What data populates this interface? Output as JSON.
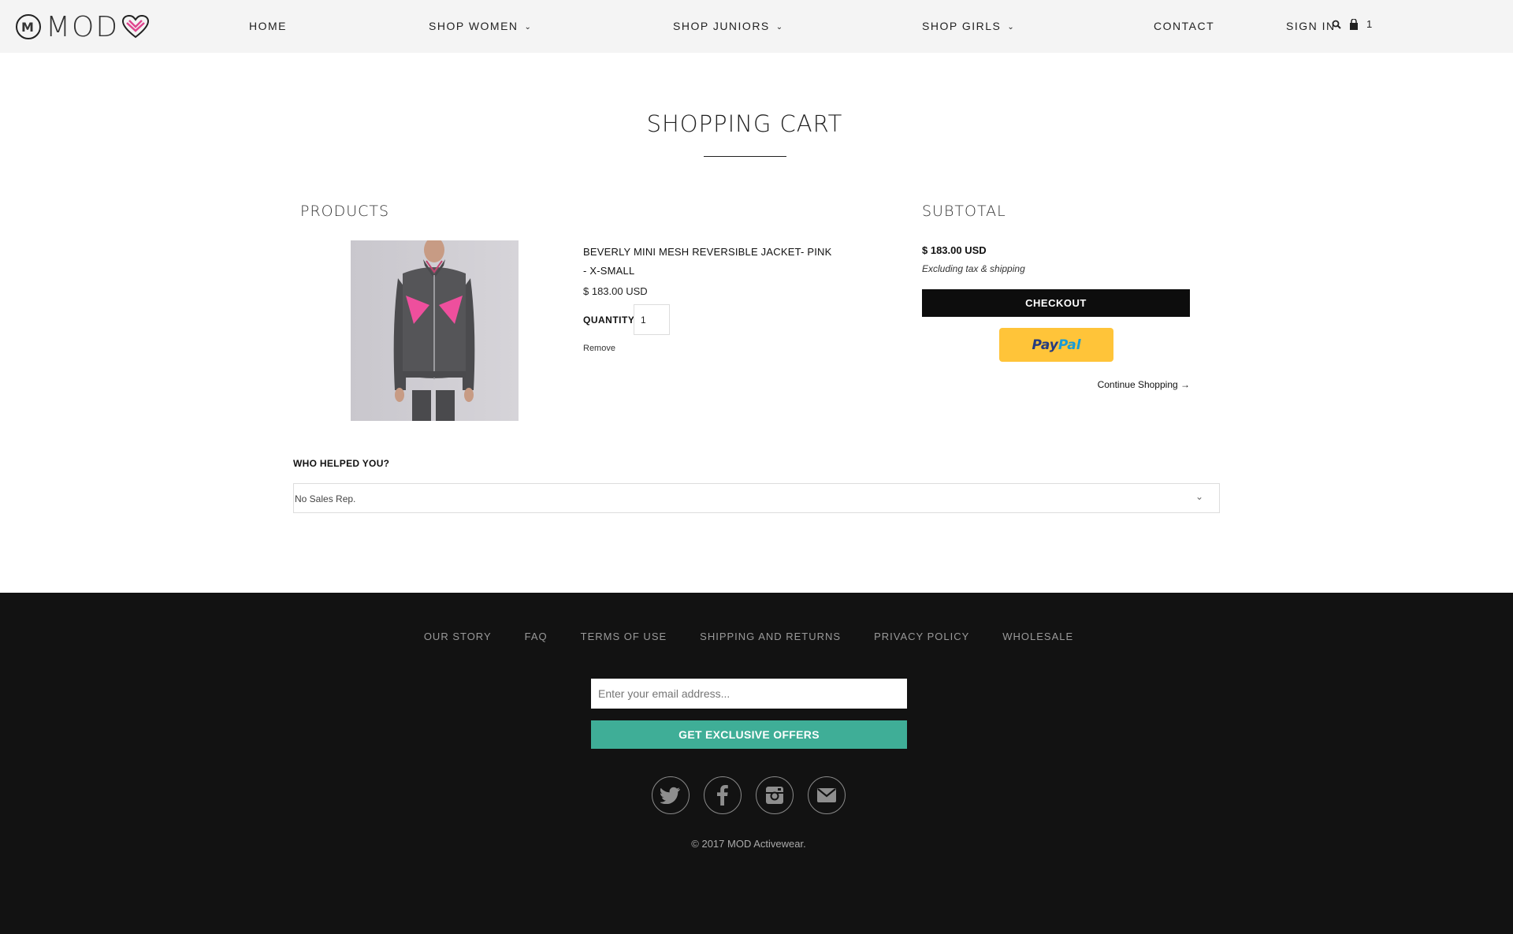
{
  "header": {
    "logo_text": "MOD",
    "nav": {
      "home": "HOME",
      "shop_women": "SHOP WOMEN",
      "shop_juniors": "SHOP JUNIORS",
      "shop_girls": "SHOP GIRLS",
      "contact": "CONTACT",
      "sign_in": "SIGN IN",
      "cart_count": "1"
    }
  },
  "main": {
    "title": "SHOPPING CART",
    "products_heading": "PRODUCTS",
    "subtotal_heading": "SUBTOTAL",
    "item": {
      "name": "BEVERLY MINI MESH REVERSIBLE JACKET- PINK - X-SMALL",
      "price": "$ 183.00 USD",
      "quantity_label": "QUANTITY:",
      "quantity": "1",
      "remove": "Remove"
    },
    "subtotal": {
      "amount": "$ 183.00 USD",
      "note": "Excluding tax & shipping",
      "checkout": "CHECKOUT",
      "paypal_pay": "Pay",
      "paypal_pal": "Pal",
      "continue": "Continue Shopping →"
    },
    "helped": {
      "label": "WHO HELPED YOU?",
      "selected": "No Sales Rep."
    }
  },
  "footer": {
    "links": [
      "OUR STORY",
      "FAQ",
      "TERMS OF USE",
      "SHIPPING AND RETURNS",
      "PRIVACY POLICY",
      "WHOLESALE"
    ],
    "email_placeholder": "Enter your email address...",
    "offers_button": "GET EXCLUSIVE OFFERS",
    "social_icons": [
      "twitter-icon",
      "facebook-icon",
      "instagram-icon",
      "mail-icon"
    ],
    "copyright": "© 2017 MOD Activewear."
  },
  "colors": {
    "header_bg": "#f4f4f4",
    "footer_bg": "#121212",
    "accent": "#3fae97",
    "paypal": "#ffc439",
    "logo_pink": "#e0468f"
  }
}
